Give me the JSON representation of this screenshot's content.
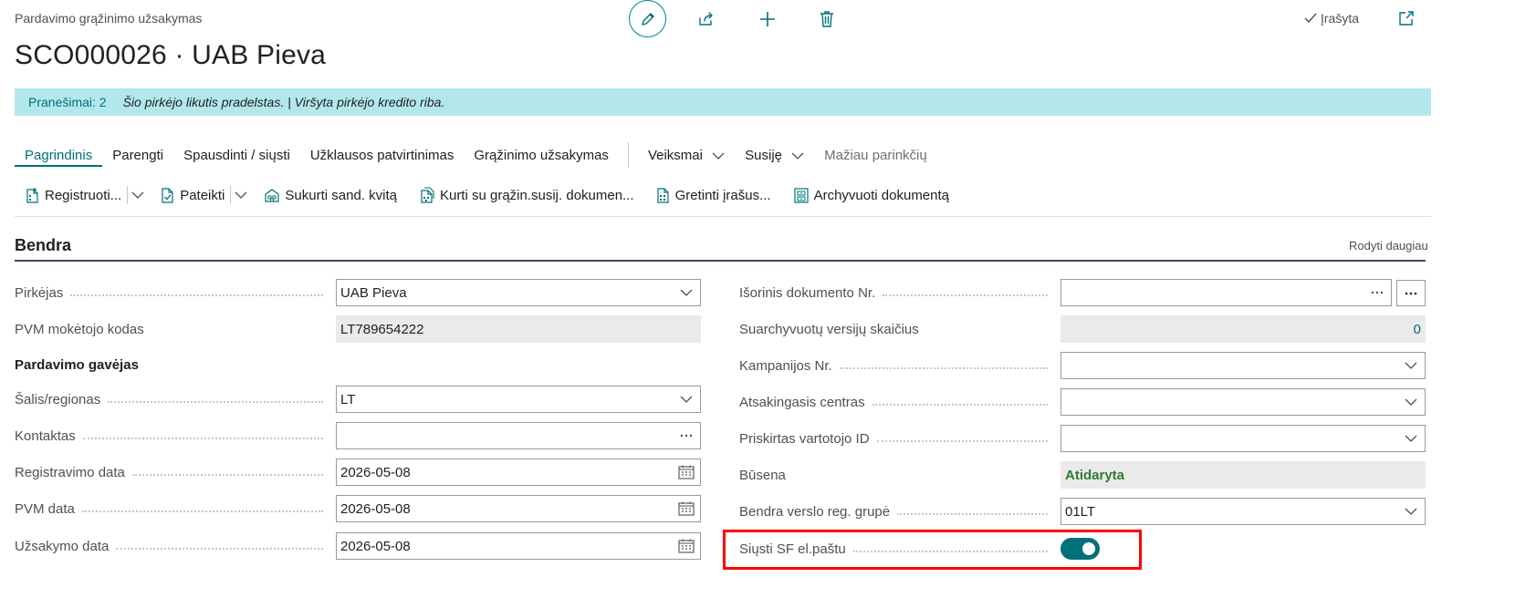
{
  "header": {
    "caption": "Pardavimo grąžinimo užsakymas",
    "title": "SCO000026 · UAB Pieva",
    "saved_label": "Įrašyta"
  },
  "notification": {
    "count_label": "Pranešimai: 2",
    "message": "Šio pirkėjo likutis pradelstas. | Viršyta pirkėjo kredito riba."
  },
  "tabs": [
    {
      "label": "Pagrindinis"
    },
    {
      "label": "Parengti"
    },
    {
      "label": "Spausdinti / siųsti"
    },
    {
      "label": "Užklausos patvirtinimas"
    },
    {
      "label": "Grąžinimo užsakymas"
    },
    {
      "label": "Veiksmai"
    },
    {
      "label": "Susiję"
    },
    {
      "label": "Mažiau parinkčių"
    }
  ],
  "actions": [
    {
      "label": "Registruoti...",
      "icon": "post-document-icon"
    },
    {
      "label": "Pateikti",
      "icon": "release-document-icon"
    },
    {
      "label": "Sukurti sand. kvitą",
      "icon": "warehouse-receipt-icon"
    },
    {
      "label": "Kurti su grąžin.susij. dokumen...",
      "icon": "related-documents-icon"
    },
    {
      "label": "Gretinti įrašus...",
      "icon": "apply-entries-icon"
    },
    {
      "label": "Archyvuoti dokumentą",
      "icon": "archive-icon"
    }
  ],
  "section": {
    "title": "Bendra",
    "show_more": "Rodyti daugiau"
  },
  "left_fields": {
    "customer": {
      "label": "Pirkėjas",
      "value": "UAB Pieva"
    },
    "vat_code": {
      "label": "PVM mokėtojo kodas",
      "value": "LT789654222"
    },
    "ship_to_heading": "Pardavimo gavėjas",
    "country": {
      "label": "Šalis/regionas",
      "value": "LT"
    },
    "contact": {
      "label": "Kontaktas",
      "value": ""
    },
    "posting_date": {
      "label": "Registravimo data",
      "value": "2026-05-08"
    },
    "vat_date": {
      "label": "PVM data",
      "value": "2026-05-08"
    },
    "order_date": {
      "label": "Užsakymo data",
      "value": "2026-05-08"
    }
  },
  "right_fields": {
    "external_doc": {
      "label": "Išorinis dokumento Nr.",
      "value": ""
    },
    "archived_versions": {
      "label": "Suarchyvuotų versijų skaičius",
      "value": "0"
    },
    "campaign": {
      "label": "Kampanijos Nr.",
      "value": ""
    },
    "responsibility_center": {
      "label": "Atsakingasis centras",
      "value": ""
    },
    "assigned_user": {
      "label": "Priskirtas vartotojo ID",
      "value": ""
    },
    "status": {
      "label": "Būsena",
      "value": "Atidaryta"
    },
    "bus_posting_group": {
      "label": "Bendra verslo reg. grupė",
      "value": "01LT"
    },
    "send_invoice_email": {
      "label": "Siųsti SF el.paštu",
      "value": true
    }
  },
  "colors": {
    "accent": "#00707a",
    "notification_bg": "#b2e8ec",
    "status_green": "#2e7d32",
    "highlight_red": "#ff0000"
  }
}
